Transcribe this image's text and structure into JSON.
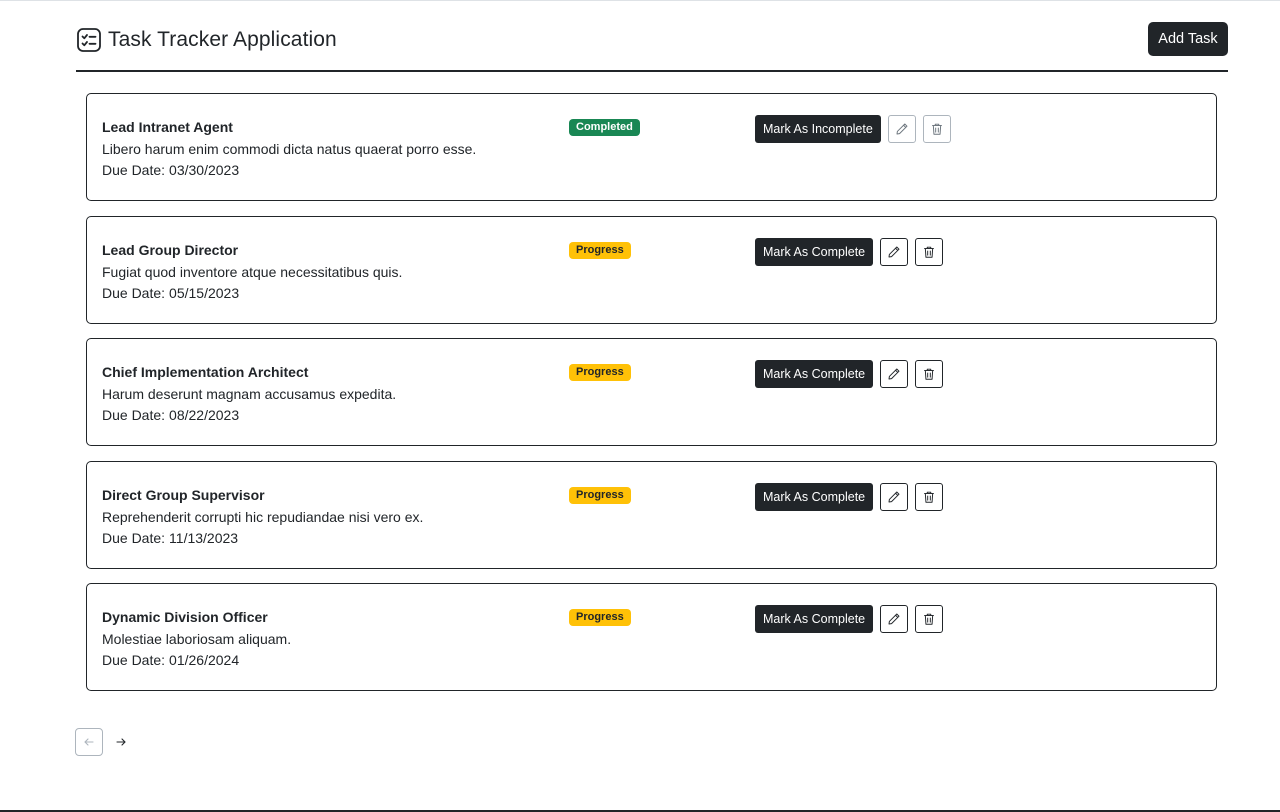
{
  "header": {
    "title": "Task Tracker Application",
    "add_task_label": "Add Task"
  },
  "due_label": "Due Date:",
  "tasks": [
    {
      "title": "Lead Intranet Agent",
      "description": "Libero harum enim commodi dicta natus quaerat porro esse.",
      "due_date": "03/30/2023",
      "status": "Completed",
      "action_label": "Mark As Incomplete"
    },
    {
      "title": "Lead Group Director",
      "description": "Fugiat quod inventore atque necessitatibus quis.",
      "due_date": "05/15/2023",
      "status": "Progress",
      "action_label": "Mark As Complete"
    },
    {
      "title": "Chief Implementation Architect",
      "description": "Harum deserunt magnam accusamus expedita.",
      "due_date": "08/22/2023",
      "status": "Progress",
      "action_label": "Mark As Complete"
    },
    {
      "title": "Direct Group Supervisor",
      "description": "Reprehenderit corrupti hic repudiandae nisi vero ex.",
      "due_date": "11/13/2023",
      "status": "Progress",
      "action_label": "Mark As Complete"
    },
    {
      "title": "Dynamic Division Officer",
      "description": "Molestiae laboriosam aliquam.",
      "due_date": "01/26/2024",
      "status": "Progress",
      "action_label": "Mark As Complete"
    }
  ],
  "icons": {
    "app": "checklist-icon",
    "edit": "pencil-icon",
    "delete": "trash-icon",
    "prev": "arrow-left-icon",
    "next": "arrow-right-icon"
  },
  "colors": {
    "primary_dark": "#212529",
    "completed_badge": "#198754",
    "progress_badge": "#ffc107",
    "disabled_border": "#adb5bd"
  }
}
